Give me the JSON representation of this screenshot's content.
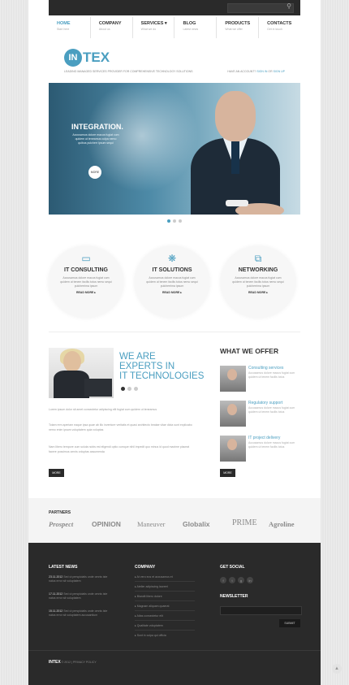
{
  "nav": [
    {
      "label": "HOME",
      "sub": "Start here"
    },
    {
      "label": "COMPANY",
      "sub": "About us"
    },
    {
      "label": "SERVICES",
      "sub": "What we do"
    },
    {
      "label": "BLOG",
      "sub": "Latest news"
    },
    {
      "label": "PRODUCTS",
      "sub": "What we offer"
    },
    {
      "label": "CONTACTS",
      "sub": "Get in touch"
    }
  ],
  "logo": {
    "mark": "IN",
    "rest": "TEX"
  },
  "tagline": "LEADING MANAGED SERVICES PROVIDER FOR COMPREHENSIVE TECHNOLOGY SOLUTIONS",
  "account": {
    "prefix": "HAVE AN ACCOUNT?",
    "signin": "SIGN IN",
    "or": "OR",
    "signup": "SIGN UP"
  },
  "slider": {
    "title": "INTEGRATION.",
    "text": "Accusamus dolore macus fugiat cum quidem ut teneamus culpa nemo quibus pulcherr ipsum sequi",
    "button": "MORE"
  },
  "services": [
    {
      "title": "IT CONSULTING",
      "text": "Accusamus dolore macus fugiat cum quidem ut tenem facilis totus nemo sequi pulcherrima ipsum",
      "more": "READ MORE"
    },
    {
      "title": "IT SOLUTIONS",
      "text": "Accusamus dolore macus fugiat cum quidem ut tenem facilis totus nemo sequi pulcherrima ipsum",
      "more": "READ MORE"
    },
    {
      "title": "NETWORKING",
      "text": "Accusamus dolore macus fugiat cum quidem ut tenem facilis totus nemo sequi pulcherrima ipsum",
      "more": "READ MORE"
    }
  ],
  "experts": {
    "line1": "WE ARE",
    "line2": "EXPERTS IN",
    "line3": "IT TECHNOLOGIES",
    "p1": "Lorem ipsum dolor sit amet consectetur adipiscing elit fugiat cum quidem ut teneamus",
    "p2": "Totam rem aperiam eaque ipsa quae ab illo inventore veritatis et quasi architecto beatae vitae dicta sunt explicabo nemo enim ipsam voluptatem quia voluptas",
    "p3": "Nam libero tempore cum soluta nobis est eligendi optio cumque nihil impedit quo minus id quod maxime placeat facere possimus omnis voluptas assumenda",
    "button": "MORE"
  },
  "offer": {
    "title": "WHAT WE OFFER",
    "items": [
      {
        "title": "Consulting services",
        "text": "Accusamus dolore macus fugiat cum quidem ut tenem facilis totus"
      },
      {
        "title": "Regulatory support",
        "text": "Accusamus dolore macus fugiat cum quidem ut tenem facilis totus"
      },
      {
        "title": "IT project delivery",
        "text": "Accusamus dolore macus fugiat cum quidem ut tenem facilis totus"
      }
    ],
    "button": "MORE"
  },
  "partners": {
    "label": "PARTNERS",
    "names": [
      "Prospect",
      "OPINION",
      "Maneuver",
      "Globalix",
      "PRIME",
      "Agroline"
    ]
  },
  "footer": {
    "news_title": "LATEST NEWS",
    "news": [
      {
        "date": "23.11.2012",
        "text": "Sed ut perspiciatis unde omnis iste natus error sit voluptatem"
      },
      {
        "date": "17.11.2012",
        "text": "Sed ut perspiciatis unde omnis iste natus error sit voluptatem"
      },
      {
        "date": "15.11.2012",
        "text": "Sed ut perspiciatis unde omnis iste natus error sit voluptatem accusantium"
      }
    ],
    "company_title": "COMPANY",
    "company_links": [
      "At vero eos et accusamus et",
      "Atelier adipiscing laoreet",
      "Blandit libero dolore",
      "Magnam aliquam quaerat",
      "Atlas consectetur elit",
      "Qualitate voluptatem",
      "Sunt in culpa qui officia"
    ],
    "social_title": "GET SOCIAL",
    "social_icons": [
      "f",
      "t",
      "g",
      "in"
    ],
    "newsletter_title": "NEWSLETTER",
    "submit": "SUBMIT",
    "copyright_brand": "INTEX",
    "copyright": "© 2012 | PRIVACY POLICY"
  }
}
